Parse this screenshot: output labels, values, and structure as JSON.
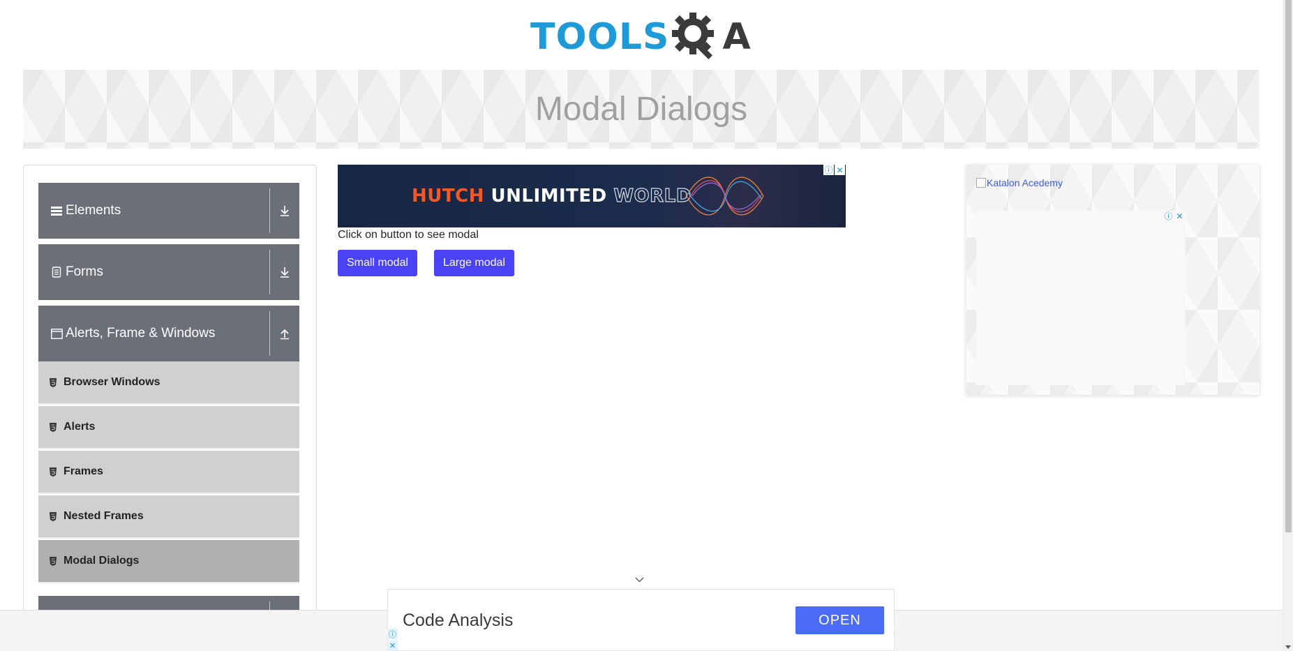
{
  "logo": {
    "word1": "TOOLS",
    "word2": "A"
  },
  "banner": {
    "title": "Modal Dialogs"
  },
  "sidebar": {
    "groups": [
      {
        "label": "Elements",
        "icon": "menu-lines-icon",
        "toggle": "download-arrow-icon"
      },
      {
        "label": "Forms",
        "icon": "document-icon",
        "toggle": "download-arrow-icon"
      },
      {
        "label": "Alerts, Frame & Windows",
        "icon": "window-icon",
        "toggle": "upload-arrow-icon"
      }
    ],
    "items": [
      {
        "label": "Browser Windows",
        "active": false
      },
      {
        "label": "Alerts",
        "active": false
      },
      {
        "label": "Frames",
        "active": false
      },
      {
        "label": "Nested Frames",
        "active": false
      },
      {
        "label": "Modal Dialogs",
        "active": true
      }
    ]
  },
  "ad_top": {
    "part1": "HUTCH",
    "part2": "UNLIMITED",
    "part3": "WORLD"
  },
  "main": {
    "prompt": "Click on button to see modal",
    "small_modal": "Small modal",
    "large_modal": "Large modal"
  },
  "right_ad": {
    "link_text": "Katalon Acedemy"
  },
  "bottom_ad": {
    "title": "Code Analysis",
    "button": "OPEN"
  },
  "colors": {
    "primary_button": "#4a42f5",
    "sidebar_header": "#6b7078",
    "logo_blue": "#1e9bd7",
    "logo_dark": "#3b3b3b"
  }
}
